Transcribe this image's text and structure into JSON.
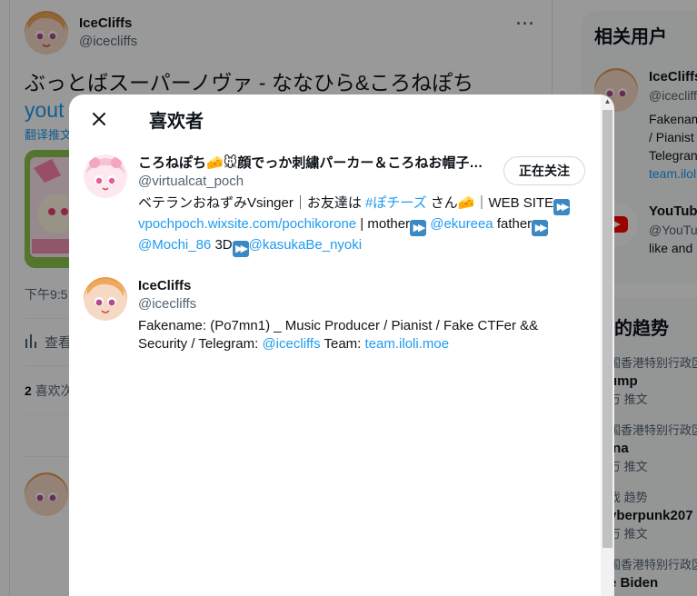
{
  "tweet": {
    "author_name": "IceCliffs",
    "author_handle": "@icecliffs",
    "text": "ぶっとばスーパーノヴァ - ななひら&ころねぽち",
    "link_fragment": "yout",
    "translate": "翻译推文",
    "timestamp_fragment": "下午9:5",
    "views_fragment": "查看",
    "likes_count": "2",
    "likes_label_fragment": "喜欢次"
  },
  "sidebar": {
    "title": "相关用户",
    "users": [
      {
        "name": "IceCliffs",
        "handle": "@icecliff",
        "bio": [
          "Fakenam",
          "/ Pianist",
          "Telegran"
        ],
        "link": "team.ilol"
      },
      {
        "name": "YouTub",
        "handle": "@YouTu",
        "bio": [
          "like and"
        ]
      }
    ],
    "trends_title": "的趋势",
    "trends": [
      {
        "category": "国香港特别行政区",
        "term": "ump",
        "count": "万 推文"
      },
      {
        "category": "国香港特别行政区",
        "term": "ina",
        "count": "万 推文"
      },
      {
        "category": "戏 趋势",
        "term": "yberpunk207",
        "count": "万 推文"
      },
      {
        "category": "国香港特别行政区",
        "term": "e Biden",
        "count": ""
      }
    ]
  },
  "modal": {
    "title": "喜欢者",
    "users": [
      {
        "name": "ころねぽち🧀🐭顔でっか刺繍パーカー＆ころねお帽子…",
        "handle": "@virtualcat_poch",
        "follow_label": "正在关注",
        "bio": {
          "t1": "ベテランおねずみVsinger｜お友達は ",
          "hashtag": "#ぽチーズ",
          "t2": " さん🧀｜WEB SITE",
          "link1": "vpochpoch.wixsite.com/pochikorone",
          "t3": " | mother",
          "mention1": "@ekureea",
          "t4": " father",
          "mention2": "@Mochi_86",
          "t5": " 3D",
          "mention3": "@kasukaBe_nyoki"
        }
      },
      {
        "name": "IceCliffs",
        "handle": "@icecliffs",
        "bio": {
          "t1": "Fakename: (Po7mn1) _ Music Producer / Pianist / Fake CTFer && Security / Telegram: ",
          "mention1": "@icecliffs",
          "t2": " Team: ",
          "link1": "team.iloli.moe"
        }
      }
    ]
  }
}
